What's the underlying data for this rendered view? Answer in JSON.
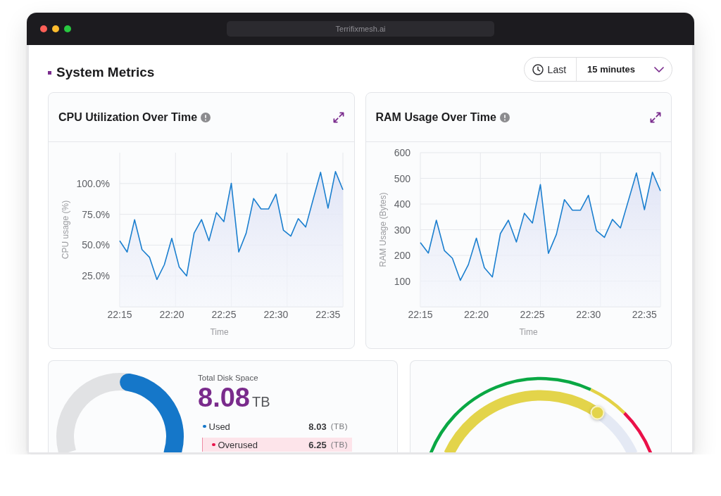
{
  "browser": {
    "url": "Terrifixmesh.ai"
  },
  "page": {
    "title": "System Metrics",
    "time_range": {
      "label": "Last",
      "value": "15 minutes"
    }
  },
  "charts": [
    {
      "title": "CPU Utilization Over Time",
      "chart_data": {
        "type": "area",
        "grid": true,
        "xlabel": "Time",
        "ylabel": "CPU usage (%)",
        "categories": [
          "22:15",
          null,
          null,
          null,
          null,
          null,
          null,
          "22:20",
          null,
          null,
          null,
          null,
          null,
          null,
          "22:25",
          null,
          null,
          null,
          null,
          null,
          null,
          "22:30",
          null,
          null,
          null,
          null,
          null,
          null,
          "22:35",
          null,
          null
        ],
        "series": [
          {
            "color": "#1b7fcf",
            "values": [
              53.5,
              44.4,
              70.6,
              46.4,
              40.2,
              22.1,
              34.1,
              55.5,
              32.2,
              25.0,
              59.7,
              70.7,
              53.5,
              76.4,
              69.0,
              100.2,
              44.4,
              59.7,
              87.8,
              79.3,
              79.3,
              91.4,
              62.2,
              57.3,
              71.5,
              64.7,
              87.0,
              109.1,
              80.0,
              109.7,
              94.9
            ]
          }
        ],
        "ylim": [
          0,
          125
        ],
        "yticks": [
          {
            "value": 25,
            "label": "25.0%"
          },
          {
            "value": 50,
            "label": "50.0%"
          },
          {
            "value": 75,
            "label": "75.0%"
          },
          {
            "value": 100,
            "label": "100.0%"
          }
        ]
      }
    },
    {
      "title": "RAM Usage Over Time",
      "chart_data": {
        "type": "area",
        "grid": true,
        "xlabel": "Time",
        "ylabel": "RAM Usage (Bytes)",
        "categories": [
          "22:15",
          null,
          null,
          null,
          null,
          null,
          null,
          "22:20",
          null,
          null,
          null,
          null,
          null,
          null,
          "22:25",
          null,
          null,
          null,
          null,
          null,
          null,
          "22:30",
          null,
          null,
          null,
          null,
          null,
          null,
          "22:35",
          null,
          null
        ],
        "series": [
          {
            "color": "#1b7fcf",
            "values": [
              250,
              209,
              337,
              219,
              189,
              103,
              164,
              267,
              152,
              116,
              285,
              337,
              252,
              364,
              326,
              476,
              208,
              282,
              417,
              376,
              376,
              434,
              296,
              270,
              340,
              307,
              414,
              521,
              378,
              524,
              451
            ]
          }
        ],
        "ylim": [
          0,
          600
        ],
        "yticks": [
          100,
          200,
          300,
          400,
          500,
          600
        ]
      }
    }
  ],
  "disk": {
    "label": "Total Disk Space",
    "total": "8.08",
    "unit": "TB",
    "rows": [
      {
        "label": "Used",
        "value": "8.03",
        "unit": "(TB)",
        "color": "#1577c9",
        "highlighted": false
      },
      {
        "label": "Overused",
        "value": "6.25",
        "unit": "(TB)",
        "color": "#e8124a",
        "highlighted": true
      }
    ]
  }
}
